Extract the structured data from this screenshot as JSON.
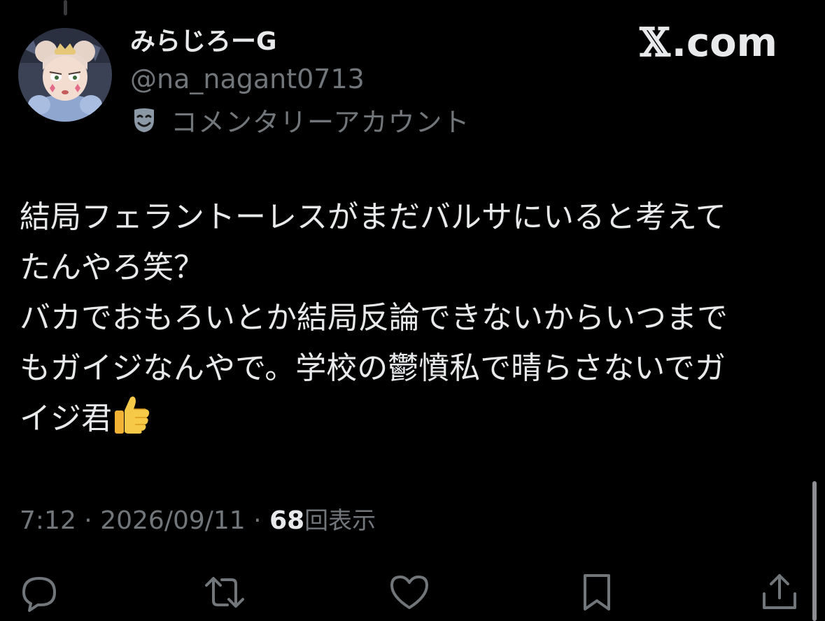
{
  "author": {
    "display_name": "みらじろーG",
    "handle": "@na_nagant0713",
    "label": "コメンタリーアカウント",
    "label_icon": "theater-mask-icon",
    "avatar_icon": "cartoon-avatar"
  },
  "watermark": {
    "x": "𝕏",
    "text": ".com"
  },
  "tweet": {
    "lines": [
      "結局フェラントーレスがまだバルサにいると考えて",
      "たんやろ笑？",
      "バカでおもろいとか結局反論できないからいつまで",
      "もガイジなんやで。学校の鬱憤私で晴らさないでガ",
      "イジ君"
    ],
    "trailing_emoji": "thumbs-up-icon"
  },
  "meta": {
    "time": "7:12",
    "separator": "·",
    "date": "2026/09/11",
    "views_count": "68",
    "views_label": "回表示"
  },
  "actions": [
    {
      "name": "reply",
      "icon": "reply-icon"
    },
    {
      "name": "retweet",
      "icon": "retweet-icon"
    },
    {
      "name": "like",
      "icon": "heart-icon"
    },
    {
      "name": "bookmark",
      "icon": "bookmark-icon"
    },
    {
      "name": "share",
      "icon": "share-icon"
    }
  ],
  "colors": {
    "background": "#000000",
    "primary_text": "#e7e9ea",
    "secondary_text": "#71767b",
    "icon": "#71767b"
  }
}
